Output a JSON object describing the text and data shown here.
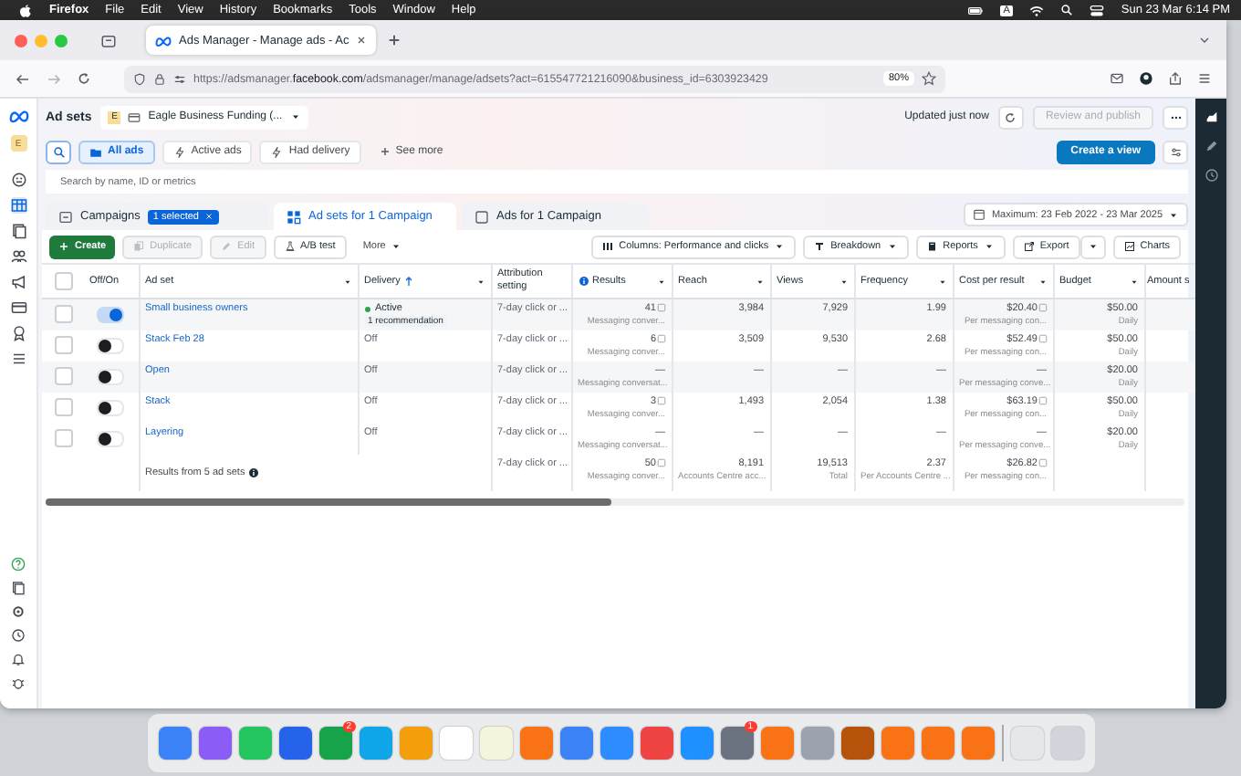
{
  "menu_bar": {
    "menus": [
      "Firefox",
      "File",
      "Edit",
      "View",
      "History",
      "Bookmarks",
      "Tools",
      "Window",
      "Help"
    ],
    "input_source": "A",
    "clock": "Sun 23 Mar 6:14 PM"
  },
  "browser": {
    "tab_title": "Ads Manager - Manage ads - Ac",
    "url": "https://adsmanager.**facebook.com**/adsmanager/manage/adsets?act=615547721216090&business_id=6303923429",
    "zoom": "80%"
  },
  "nav_avatar_letter": "E",
  "header": {
    "title": "Ad sets",
    "account_letter": "E",
    "account": "Eagle Business Funding (...",
    "updated": "Updated just now",
    "review_button": {
      "label": "Review and publish",
      "disabled": true
    }
  },
  "filters": [
    {
      "kind": "chip",
      "label": "All ads",
      "selected": true
    },
    {
      "kind": "chip",
      "label": "Active ads",
      "selected": false
    },
    {
      "kind": "chip",
      "label": "Had delivery",
      "selected": false
    },
    {
      "kind": "add",
      "label": "See more",
      "selected": false
    }
  ],
  "create_view_button": "Create a view",
  "search": {
    "placeholder": "Search by name, ID or metrics"
  },
  "level_tabs": [
    {
      "kind": "campaigns",
      "label": "Campaigns",
      "badge": "1 selected",
      "selected": false
    },
    {
      "kind": "adsets",
      "label": "Ad sets for 1 Campaign",
      "selected": true
    },
    {
      "kind": "ads",
      "label": "Ads for 1 Campaign",
      "selected": false
    }
  ],
  "date_range": "Maximum: 23 Feb 2022 - 23 Mar 2025",
  "toolbar": [
    {
      "kind": "create",
      "label": "Create",
      "disabled": false
    },
    {
      "kind": "duplicate",
      "label": "Duplicate",
      "disabled": true
    },
    {
      "kind": "edit",
      "label": "Edit",
      "disabled": true
    },
    {
      "kind": "abtest",
      "label": "A/B test",
      "disabled": false
    },
    {
      "kind": "more",
      "label": "More",
      "disabled": false
    }
  ],
  "toolbar_right": [
    {
      "kind": "columns",
      "label": "Columns: Performance and clicks"
    },
    {
      "kind": "breakdown",
      "label": "Breakdown"
    },
    {
      "kind": "reports",
      "label": "Reports"
    },
    {
      "kind": "export",
      "label": "Export"
    },
    {
      "kind": "charts",
      "label": "Charts"
    }
  ],
  "table": {
    "select_all_checked": false,
    "columns": [
      {
        "label": "Off/On",
        "menu": false,
        "sorted": false,
        "info": false
      },
      {
        "label": "Ad set",
        "menu": true,
        "sorted": false,
        "info": false
      },
      {
        "label": "Delivery",
        "menu": true,
        "sorted": true,
        "info": false
      },
      {
        "label": "Attribution setting",
        "menu": false,
        "sorted": false,
        "info": false
      },
      {
        "label": "Results",
        "menu": true,
        "sorted": false,
        "info": true
      },
      {
        "label": "Reach",
        "menu": true,
        "sorted": false,
        "info": false
      },
      {
        "label": "Views",
        "menu": true,
        "sorted": false,
        "info": false
      },
      {
        "label": "Frequency",
        "menu": true,
        "sorted": false,
        "info": false
      },
      {
        "label": "Cost per result",
        "menu": true,
        "sorted": false,
        "info": false
      },
      {
        "label": "Budget",
        "menu": true,
        "sorted": false,
        "info": false
      },
      {
        "label": "Amount s",
        "menu": false,
        "sorted": false,
        "info": false
      }
    ],
    "rows": [
      {
        "checked": false,
        "on": true,
        "name": "Small business owners",
        "delivery": "Active",
        "active": true,
        "note": "1 recommendation",
        "attribution": "7-day click or ...",
        "results": "41",
        "results_sub": "Messaging conver...",
        "reach": "3,984",
        "views": "7,929",
        "frequency": "1.99",
        "cost": "$20.40",
        "cost_sub": "Per messaging con...",
        "budget": "$50.00",
        "budget_sub": "Daily"
      },
      {
        "checked": false,
        "on": false,
        "name": "Stack Feb 28",
        "delivery": "Off",
        "active": false,
        "attribution": "7-day click or ...",
        "results": "6",
        "results_sub": "Messaging conver...",
        "reach": "3,509",
        "views": "9,530",
        "frequency": "2.68",
        "cost": "$52.49",
        "cost_sub": "Per messaging con...",
        "budget": "$50.00",
        "budget_sub": "Daily"
      },
      {
        "checked": false,
        "on": false,
        "name": "Open",
        "delivery": "Off",
        "active": false,
        "attribution": "7-day click or ...",
        "results": "—",
        "results_sub": "Messaging conversat...",
        "reach": "—",
        "views": "—",
        "frequency": "—",
        "cost": "—",
        "cost_sub": "Per messaging conve...",
        "budget": "$20.00",
        "budget_sub": "Daily"
      },
      {
        "checked": false,
        "on": false,
        "name": "Stack",
        "delivery": "Off",
        "active": false,
        "attribution": "7-day click or ...",
        "results": "3",
        "results_sub": "Messaging conver...",
        "reach": "1,493",
        "views": "2,054",
        "frequency": "1.38",
        "cost": "$63.19",
        "cost_sub": "Per messaging con...",
        "budget": "$50.00",
        "budget_sub": "Daily"
      },
      {
        "checked": false,
        "on": false,
        "name": "Layering",
        "delivery": "Off",
        "active": false,
        "attribution": "7-day click or ...",
        "results": "—",
        "results_sub": "Messaging conversat...",
        "reach": "—",
        "views": "—",
        "frequency": "—",
        "cost": "—",
        "cost_sub": "Per messaging conve...",
        "budget": "$20.00",
        "budget_sub": "Daily"
      }
    ],
    "totals": {
      "label": "Results from 5 ad sets",
      "attribution": "7-day click or ...",
      "results": "50",
      "results_sub": "Messaging conver...",
      "reach": "8,191",
      "reach_sub": "Accounts Centre acc...",
      "views": "19,513",
      "views_sub": "Total",
      "frequency": "2.37",
      "frequency_sub": "Per Accounts Centre ...",
      "cost": "$26.82",
      "cost_sub": "Per messaging con..."
    }
  },
  "dock": [
    {
      "color": "#3b82f6"
    },
    {
      "color": "#8b5cf6"
    },
    {
      "color": "#22c55e"
    },
    {
      "color": "#2563eb"
    },
    {
      "color": "#16a34a",
      "badge": "2"
    },
    {
      "color": "#0ea5e9"
    },
    {
      "color": "#f59e0b"
    },
    {
      "color": "#ffffff"
    },
    {
      "color": "#f5f5dc"
    },
    {
      "color": "#f97316"
    },
    {
      "color": "#3b82f6"
    },
    {
      "color": "#2d8cff"
    },
    {
      "color": "#ef4444"
    },
    {
      "color": "#1e90ff"
    },
    {
      "color": "#6b7280",
      "badge": "1"
    },
    {
      "color": "#f97316"
    },
    {
      "color": "#9ca3af"
    },
    {
      "color": "#b45309"
    },
    {
      "color": "#f97316"
    },
    {
      "color": "#f97316"
    },
    {
      "color": "#f97316"
    },
    {
      "color": "#e5e7eb"
    },
    {
      "color": "#d1d5db"
    }
  ]
}
